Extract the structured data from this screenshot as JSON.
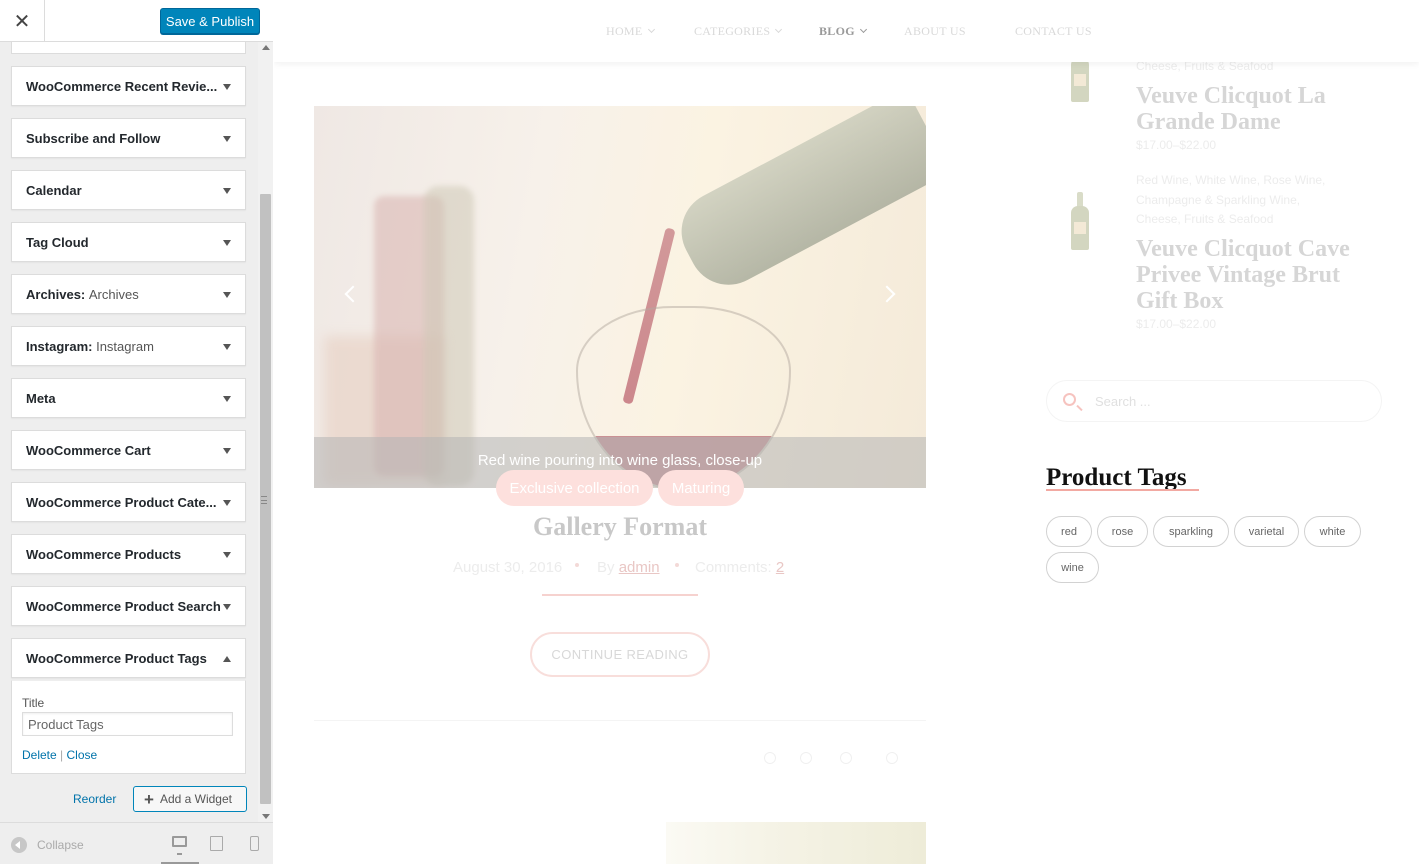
{
  "customizer": {
    "close_label": "✕",
    "save_label": "Save & Publish",
    "widgets": [
      {
        "title": "WooCommerce Recent Revie...",
        "sub": ""
      },
      {
        "title": "Subscribe and Follow",
        "sub": ""
      },
      {
        "title": "Calendar",
        "sub": ""
      },
      {
        "title": "Tag Cloud",
        "sub": ""
      },
      {
        "title": "Archives:",
        "sub": "Archives"
      },
      {
        "title": "Instagram:",
        "sub": "Instagram"
      },
      {
        "title": "Meta",
        "sub": ""
      },
      {
        "title": "WooCommerce Cart",
        "sub": ""
      },
      {
        "title": "WooCommerce Product Cate...",
        "sub": ""
      },
      {
        "title": "WooCommerce Products",
        "sub": ""
      },
      {
        "title": "WooCommerce Product Search",
        "sub": ""
      },
      {
        "title": "WooCommerce Product Tags",
        "sub": ""
      }
    ],
    "expanded": {
      "title_label": "Title",
      "title_value": "Product Tags",
      "delete_label": "Delete",
      "separator": "|",
      "close_label": "Close"
    },
    "reorder_label": "Reorder",
    "add_widget_label": "Add a Widget",
    "add_widget_icon": "+",
    "footer": {
      "collapse_label": "Collapse",
      "devices": [
        "desktop-icon",
        "tablet-icon",
        "mobile-icon"
      ]
    }
  },
  "preview": {
    "nav": [
      {
        "label": "HOME",
        "has_dropdown": true,
        "active": false
      },
      {
        "label": "CATEGORIES",
        "has_dropdown": true,
        "active": false
      },
      {
        "label": "BLOG",
        "has_dropdown": true,
        "active": true
      },
      {
        "label": "ABOUT US",
        "has_dropdown": false,
        "active": false
      },
      {
        "label": "CONTACT US",
        "has_dropdown": false,
        "active": false
      }
    ],
    "slider": {
      "caption": "Red wine pouring into wine glass, close-up"
    },
    "post": {
      "categories": [
        "Exclusive collection",
        "Maturing"
      ],
      "title": "Gallery Format",
      "date": "August 30, 2016",
      "by_label": "By",
      "author": "admin",
      "comments_label": "Comments:",
      "comments_count": "2",
      "continue_label": "CONTINUE READING"
    },
    "products": [
      {
        "categories": "Cheese, Fruits & Seafood",
        "title_line1": "Veuve Clicquot La",
        "title_line2": "Grande Dame",
        "title_line3": "",
        "price": "$17.00–$22.00"
      },
      {
        "categories_line1": "Red Wine, White Wine, Rose Wine,",
        "categories_line2": "Champagne & Sparkling Wine,",
        "categories_line3": "Cheese, Fruits & Seafood",
        "title_line1": "Veuve Clicquot Cave",
        "title_line2": "Privee Vintage Brut",
        "title_line3": "Gift Box",
        "price": "$17.00–$22.00"
      }
    ],
    "search_placeholder": "Search ...",
    "tags_widget": {
      "title": "Product Tags",
      "tags": [
        "red",
        "rose",
        "sparkling",
        "varietal",
        "white",
        "wine"
      ]
    }
  },
  "colors": {
    "publish_button": "#0085ba",
    "link": "#0073aa",
    "accent_pink": "#f2a9a2"
  }
}
